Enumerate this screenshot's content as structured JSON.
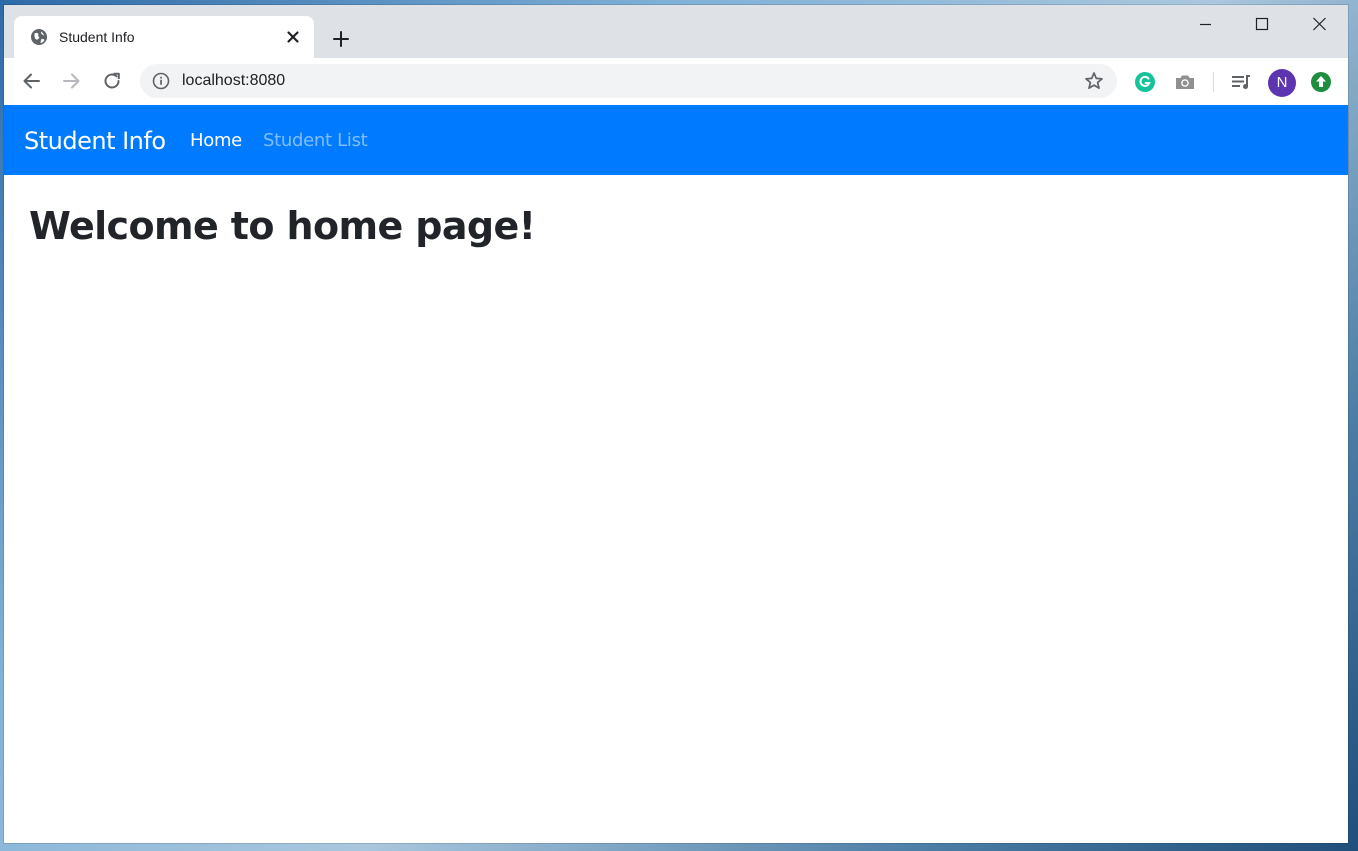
{
  "browser": {
    "tab": {
      "title": "Student Info",
      "favicon": "globe-icon"
    },
    "new_tab_icon": "plus-icon",
    "window_controls": [
      "minimize-icon",
      "maximize-icon",
      "close-icon"
    ],
    "address_bar": {
      "url": "localhost:8080",
      "info_icon": "info-icon",
      "bookmark_icon": "star-icon"
    },
    "extensions": [
      {
        "name": "grammarly-icon",
        "color": "#15c39a"
      },
      {
        "name": "camera-icon",
        "color": "#909090"
      },
      {
        "name": "media-playlist-icon",
        "color": "#5f6368"
      }
    ],
    "profile": {
      "initial": "N",
      "color": "#5e35b1"
    },
    "update_icon": {
      "name": "update-arrow-icon",
      "color": "#1e8e3e"
    }
  },
  "app": {
    "navbar": {
      "brand": "Student Info",
      "background": "#007bff",
      "links": [
        {
          "label": "Home",
          "active": true
        },
        {
          "label": "Student List",
          "active": false
        }
      ]
    },
    "main": {
      "heading": "Welcome to home page!"
    }
  }
}
